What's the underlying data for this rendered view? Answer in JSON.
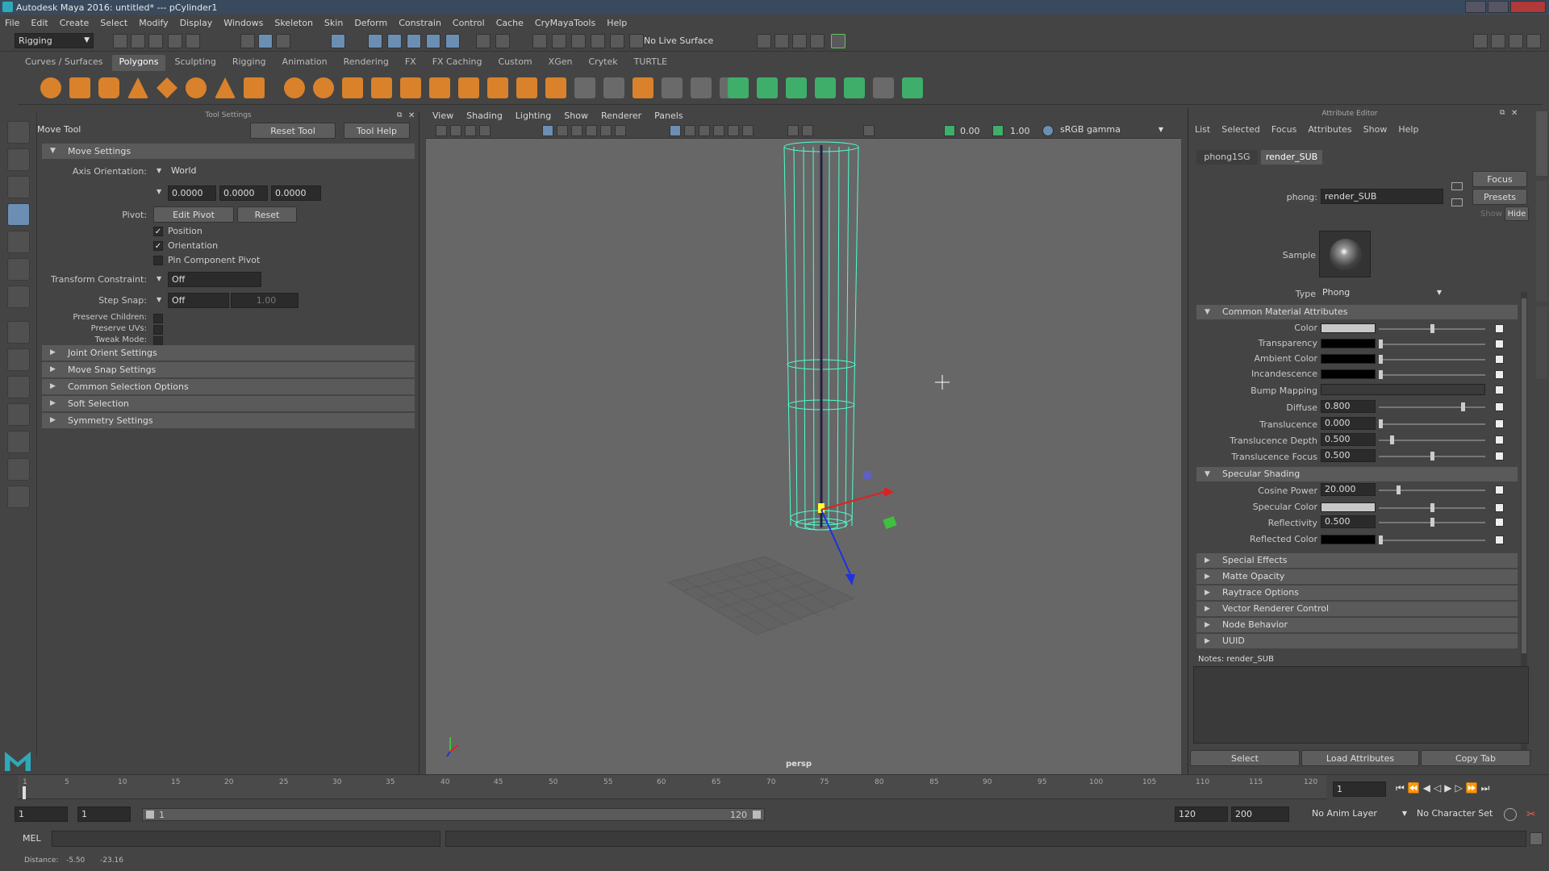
{
  "window": {
    "title": "Autodesk Maya 2016: untitled*   ---   pCylinder1"
  },
  "menubar": [
    "File",
    "Edit",
    "Create",
    "Select",
    "Modify",
    "Display",
    "Windows",
    "Skeleton",
    "Skin",
    "Deform",
    "Constrain",
    "Control",
    "Cache",
    "CryMayaTools",
    "Help"
  ],
  "statusline": {
    "menuset": "Rigging",
    "live_surface": "No Live Surface"
  },
  "shelf": {
    "tabs": [
      "Curves / Surfaces",
      "Polygons",
      "Sculpting",
      "Rigging",
      "Animation",
      "Rendering",
      "FX",
      "FX Caching",
      "Custom",
      "XGen",
      "Crytek",
      "TURTLE"
    ],
    "active_tab": "Polygons"
  },
  "tool_settings": {
    "panel_title": "Tool Settings",
    "tool_name": "Move Tool",
    "reset_tool": "Reset Tool",
    "tool_help": "Tool Help",
    "move_settings": "Move Settings",
    "axis_orientation_label": "Axis Orientation:",
    "axis_orientation_value": "World",
    "axis_values": [
      "0.0000",
      "0.0000",
      "0.0000"
    ],
    "pivot_label": "Pivot:",
    "edit_pivot": "Edit Pivot",
    "reset": "Reset",
    "position": "Position",
    "orientation": "Orientation",
    "pin_component_pivot": "Pin Component Pivot",
    "transform_constraint_label": "Transform Constraint:",
    "transform_constraint_value": "Off",
    "step_snap_label": "Step Snap:",
    "step_snap_value": "Off",
    "step_snap_amount": "1.00",
    "preserve_children": "Preserve Children:",
    "preserve_uvs": "Preserve UVs:",
    "tweak_mode": "Tweak Mode:",
    "sections": [
      "Joint Orient Settings",
      "Move Snap Settings",
      "Common Selection Options",
      "Soft Selection",
      "Symmetry Settings"
    ]
  },
  "viewport": {
    "menus": [
      "View",
      "Shading",
      "Lighting",
      "Show",
      "Renderer",
      "Panels"
    ],
    "exposure": "0.00",
    "gamma": "1.00",
    "color_space": "sRGB gamma",
    "camera": "persp"
  },
  "attribute_editor": {
    "panel_title": "Attribute Editor",
    "menus": [
      "List",
      "Selected",
      "Focus",
      "Attributes",
      "Show",
      "Help"
    ],
    "tabs": [
      "phong1SG",
      "render_SUB"
    ],
    "active_tab": "render_SUB",
    "node_label": "phong:",
    "node_name": "render_SUB",
    "focus": "Focus",
    "presets": "Presets",
    "show": "Show",
    "hide": "Hide",
    "sample_label": "Sample",
    "type_label": "Type",
    "type_value": "Phong",
    "common_section": "Common Material Attributes",
    "color": "Color",
    "transparency": "Transparency",
    "ambient_color": "Ambient Color",
    "incandescence": "Incandescence",
    "bump_mapping": "Bump Mapping",
    "diffuse": "Diffuse",
    "diffuse_value": "0.800",
    "translucence": "Translucence",
    "translucence_value": "0.000",
    "translucence_depth": "Translucence Depth",
    "translucence_depth_value": "0.500",
    "translucence_focus": "Translucence Focus",
    "translucence_focus_value": "0.500",
    "specular_section": "Specular Shading",
    "cosine_power": "Cosine Power",
    "cosine_power_value": "20.000",
    "specular_color": "Specular Color",
    "reflectivity": "Reflectivity",
    "reflectivity_value": "0.500",
    "reflected_color": "Reflected Color",
    "collapsed_sections": [
      "Special Effects",
      "Matte Opacity",
      "Raytrace Options",
      "Vector Renderer Control",
      "Node Behavior",
      "UUID"
    ],
    "notes": "Notes:  render_SUB",
    "select": "Select",
    "load_attributes": "Load Attributes",
    "copy_tab": "Copy Tab",
    "colors": {
      "color": "#c8c8c8",
      "specular": "#c8c8c8",
      "black": "#000000"
    }
  },
  "timeline": {
    "ticks": [
      "1",
      "5",
      "10",
      "15",
      "20",
      "25",
      "30",
      "35",
      "40",
      "45",
      "50",
      "55",
      "60",
      "65",
      "70",
      "75",
      "80",
      "85",
      "90",
      "95",
      "100",
      "105",
      "110",
      "115",
      "120"
    ],
    "current_frame": "1",
    "range_start": "1",
    "range_start_inner": "1",
    "range_slider_start": "1",
    "range_slider_end": "120",
    "range_end": "120",
    "anim_end": "200",
    "anim_layer": "No Anim Layer",
    "character_set": "No Character Set"
  },
  "command_line": {
    "label": "MEL"
  },
  "help_line": {
    "label": "Distance:",
    "v1": "-5.50",
    "v2": "-23.16"
  }
}
